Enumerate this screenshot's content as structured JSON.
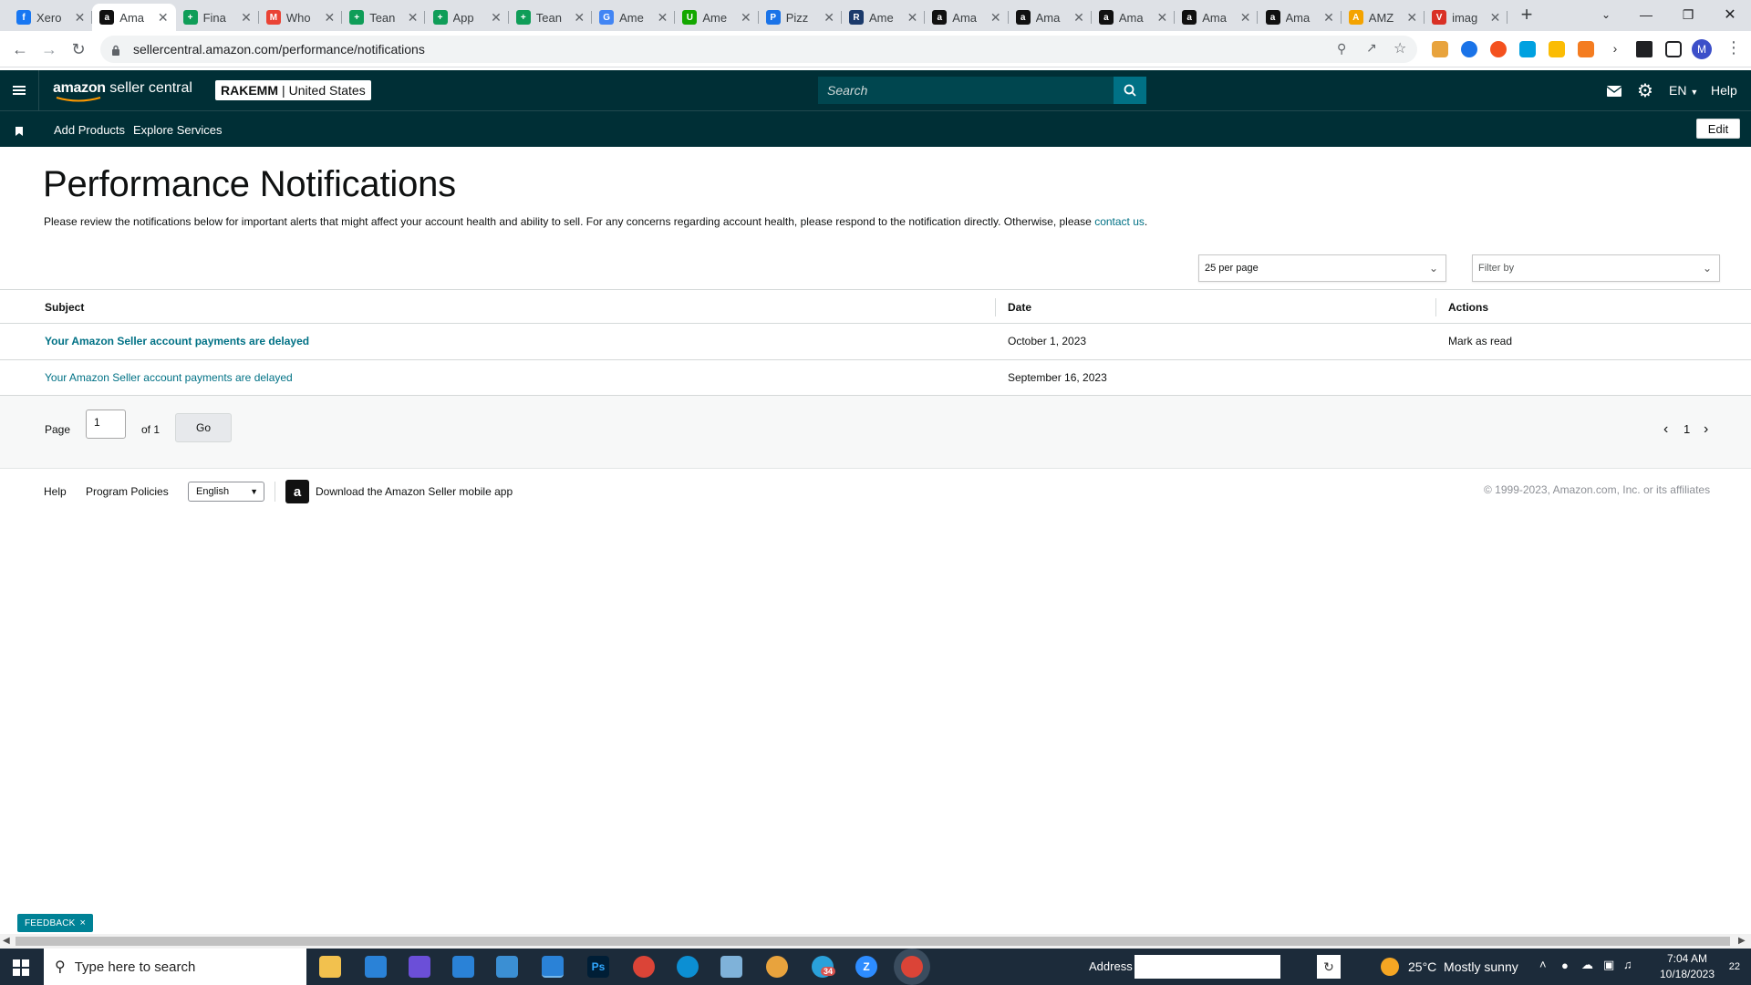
{
  "browser": {
    "tabs": [
      {
        "title": "Xero",
        "icon": "facebook-favicon",
        "color": "#1877f2",
        "glyph": "f"
      },
      {
        "title": "Ama",
        "icon": "amazon-favicon",
        "color": "#111111",
        "glyph": "a"
      },
      {
        "title": "Fina",
        "icon": "sheets-favicon",
        "color": "#0f9d58",
        "glyph": "+"
      },
      {
        "title": "Who",
        "icon": "gmail-favicon",
        "color": "#ea4335",
        "glyph": "M"
      },
      {
        "title": "Tean",
        "icon": "sheets-favicon",
        "color": "#0f9d58",
        "glyph": "+"
      },
      {
        "title": "App",
        "icon": "sheets-favicon",
        "color": "#0f9d58",
        "glyph": "+"
      },
      {
        "title": "Tean",
        "icon": "sheets-favicon",
        "color": "#0f9d58",
        "glyph": "+"
      },
      {
        "title": "Ame",
        "icon": "google-favicon",
        "color": "#4285f4",
        "glyph": "G"
      },
      {
        "title": "Ame",
        "icon": "upwork-favicon",
        "color": "#14a800",
        "glyph": "U"
      },
      {
        "title": "Pizz",
        "icon": "shield-favicon",
        "color": "#1a73e8",
        "glyph": "P"
      },
      {
        "title": "Ame",
        "icon": "rs-favicon",
        "color": "#1b3a6b",
        "glyph": "R"
      },
      {
        "title": "Ama",
        "icon": "amazon-favicon",
        "color": "#111111",
        "glyph": "a"
      },
      {
        "title": "Ama",
        "icon": "amazon-favicon",
        "color": "#111111",
        "glyph": "a"
      },
      {
        "title": "Ama",
        "icon": "amazon-favicon",
        "color": "#111111",
        "glyph": "a"
      },
      {
        "title": "Ama",
        "icon": "amazon-favicon",
        "color": "#111111",
        "glyph": "a"
      },
      {
        "title": "Ama",
        "icon": "amazon-favicon",
        "color": "#111111",
        "glyph": "a"
      },
      {
        "title": "AMZ",
        "icon": "amz-favicon",
        "color": "#f4a300",
        "glyph": "A"
      },
      {
        "title": "imag",
        "icon": "image-favicon",
        "color": "#d93025",
        "glyph": "V"
      }
    ],
    "new_tab_glyph": "+",
    "url": "sellercentral.amazon.com/performance/notifications",
    "profile_initial": "M"
  },
  "header": {
    "brand_word": "amazon",
    "brand_suffix": "seller central",
    "account_name": "RAKEMM",
    "account_region": "United States",
    "search_placeholder": "Search",
    "language": "EN",
    "help": "Help"
  },
  "subnav": {
    "items": [
      "Add Products",
      "Explore Services"
    ],
    "edit": "Edit"
  },
  "page": {
    "title": "Performance Notifications",
    "intro_text": "Please review the notifications below for important alerts that might affect your account health and ability to sell. For any concerns regarding account health, please respond to the notification directly. Otherwise, please ",
    "intro_link": "contact us",
    "intro_end": ".",
    "per_page": "25 per page",
    "filter_placeholder": "Filter by"
  },
  "table": {
    "columns": [
      "Subject",
      "Date",
      "Actions"
    ],
    "rows": [
      {
        "subject": "Your Amazon Seller account payments are delayed",
        "date": "October 1, 2023",
        "action": "Mark as read",
        "unread": true
      },
      {
        "subject": "Your Amazon Seller account payments are delayed",
        "date": "September 16, 2023",
        "action": "",
        "unread": false
      }
    ]
  },
  "pagination": {
    "page_label": "Page",
    "current": "1",
    "of_label": "of 1",
    "go": "Go",
    "page_number": "1"
  },
  "footer": {
    "help": "Help",
    "program_policies": "Program Policies",
    "language": "English",
    "app_download": "Download the Amazon Seller mobile app",
    "copyright": "© 1999-2023, Amazon.com, Inc. or its affiliates"
  },
  "feedback": {
    "label": "FEEDBACK",
    "close": "×"
  },
  "taskbar": {
    "search_placeholder": "Type here to search",
    "address_label": "Address",
    "weather": "25°C  Mostly sunny",
    "time": "7:04 AM",
    "date": "10/18/2023",
    "notifications": "22",
    "telegram_badge": "34"
  },
  "colors": {
    "header_bg": "#002f36",
    "link": "#007185",
    "feedback": "#008296",
    "taskbar": "#1c2b3a"
  }
}
